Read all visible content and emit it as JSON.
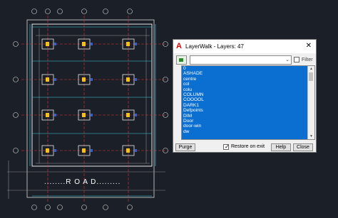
{
  "drawing": {
    "road_label": "........R O A D........."
  },
  "dialog": {
    "title": "LayerWalk - Layers: 47",
    "close_glyph": "✕",
    "filter_label": "Filter",
    "layers": [
      "0",
      "ASHADE",
      "centre",
      "col",
      "colu",
      "COLUMN",
      "COOOOL",
      "DARK1",
      "Defpoints",
      "DIM",
      "Door",
      "door-win",
      "dw"
    ],
    "purge_label": "Purge",
    "restore_label": "Restore on exit",
    "restore_checked": true,
    "help_label": "Help",
    "close_label": "Close"
  }
}
